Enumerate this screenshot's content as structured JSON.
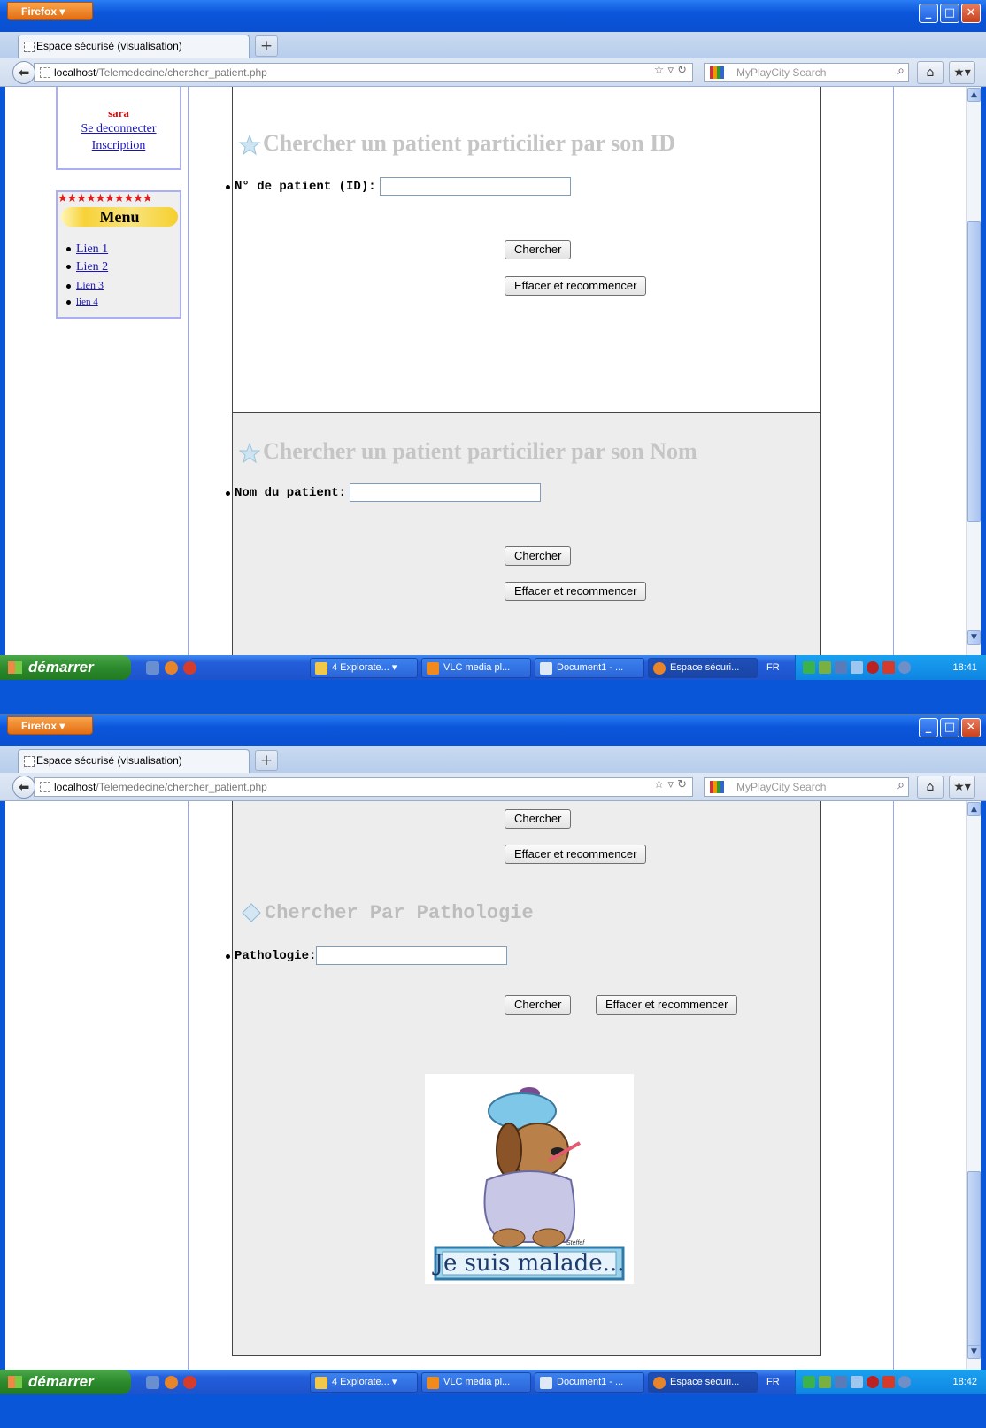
{
  "browser": {
    "menu_button": "Firefox",
    "tab_title": "Espace sécurisé (visualisation)",
    "new_tab": "+",
    "url_host": "localhost",
    "url_path": "/Telemedecine/chercher_patient.php",
    "search_placeholder": "MyPlayCity Search",
    "window_buttons": {
      "minimize": "_",
      "maximize": "□",
      "close": "✕"
    }
  },
  "sidebar": {
    "username": "sara",
    "logout_link": "Se deconnecter",
    "signup_link": "Inscription",
    "menu_stars": "★★★★★★★★★★",
    "menu_title": "Menu",
    "menu_items": [
      "Lien 1",
      "Lien 2",
      "Lien 3",
      "lien 4"
    ]
  },
  "search_id": {
    "heading": "Chercher un patient particilier par son ID",
    "field_label": "N° de patient (ID):",
    "input_value": "",
    "search_button": "Chercher",
    "reset_button": "Effacer et recommencer"
  },
  "search_name": {
    "heading": "Chercher un patient particilier par son Nom",
    "field_label": "Nom du patient:",
    "input_value": "",
    "search_button": "Chercher",
    "reset_button": "Effacer et recommencer"
  },
  "search_pathology": {
    "heading": "Chercher Par Pathologie",
    "field_label": "Pathologie:",
    "input_value": "",
    "search_button": "Chercher",
    "reset_button": "Effacer et recommencer"
  },
  "image": {
    "caption": "Je suis malade...",
    "signature": "Steffef"
  },
  "taskbar": {
    "start_label": "démarrer",
    "items": [
      "4 Explorate...",
      "VLC media pl...",
      "Document1 - ...",
      "Espace sécuri..."
    ],
    "language": "FR",
    "clock_first": "18:41",
    "clock_second": "18:42"
  }
}
